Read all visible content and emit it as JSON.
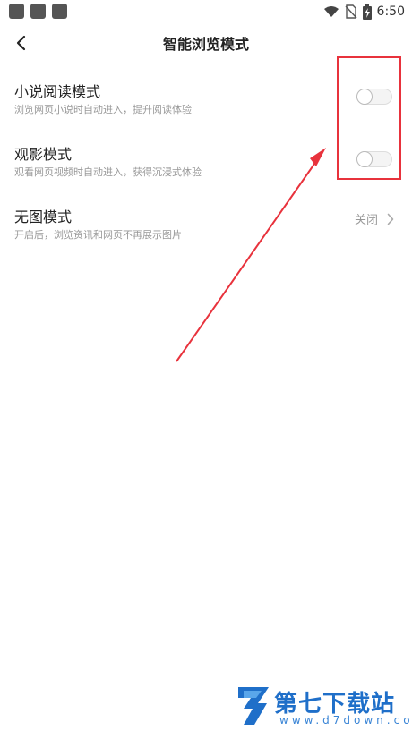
{
  "status_bar": {
    "time": "6:50",
    "icons": [
      "wifi-icon",
      "no-sim-icon",
      "battery-charging-icon"
    ]
  },
  "header": {
    "title": "智能浏览模式",
    "back_icon": "chevron-left-icon"
  },
  "settings": [
    {
      "title": "小说阅读模式",
      "desc": "浏览网页小说时自动进入，提升阅读体验",
      "control": "toggle",
      "on": false
    },
    {
      "title": "观影模式",
      "desc": "观看网页视频时自动进入，获得沉浸式体验",
      "control": "toggle",
      "on": false
    },
    {
      "title": "无图模式",
      "desc": "开启后，浏览资讯和网页不再展示图片",
      "control": "value",
      "value": "关闭"
    }
  ],
  "annotation": {
    "color": "#e8323c"
  },
  "watermark": {
    "text": "第七下载站",
    "url": "www.d7down.com",
    "color": "#1f6fc9"
  }
}
